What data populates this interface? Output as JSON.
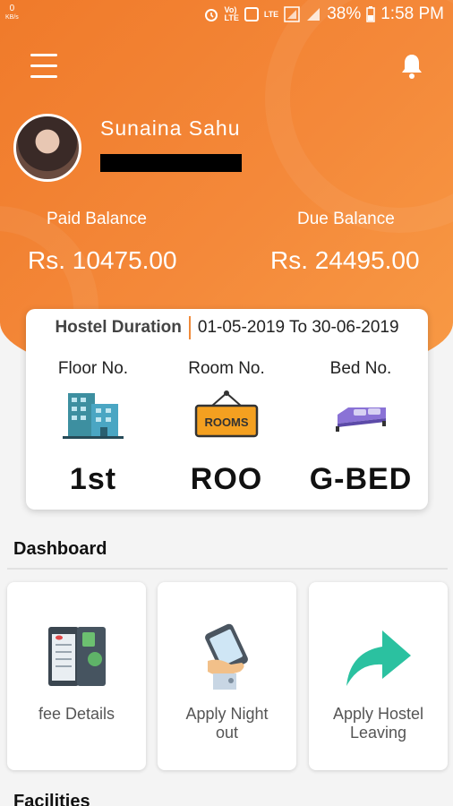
{
  "status_bar": {
    "net_speed": "0",
    "net_unit": "KB/s",
    "carrier_badge": "Vo)\nLTE",
    "lte_label": "LTE",
    "battery": "38%",
    "time": "1:58 PM"
  },
  "header": {
    "menu_icon": "hamburger-icon",
    "notification_icon": "bell-icon"
  },
  "profile": {
    "name": "Sunaina Sahu"
  },
  "balances": {
    "paid_label": "Paid Balance",
    "paid_value": "Rs. 10475.00",
    "due_label": "Due Balance",
    "due_value": "Rs. 24495.00"
  },
  "hostel": {
    "duration_label": "Hostel Duration",
    "duration_value": "01-05-2019 To 30-06-2019",
    "floor_label": "Floor No.",
    "floor_value": "1st",
    "room_label": "Room No.",
    "room_value": "ROO",
    "room_sign_text": "ROOMS",
    "bed_label": "Bed No.",
    "bed_value": "G-BED"
  },
  "dashboard": {
    "title": "Dashboard",
    "tiles": [
      {
        "label": "fee Details",
        "icon": "fee-details-icon"
      },
      {
        "label": "Apply Night out",
        "icon": "phone-hand-icon"
      },
      {
        "label": "Apply Hostel Leaving",
        "icon": "share-arrow-icon"
      }
    ]
  },
  "facilities": {
    "title": "Facilities"
  },
  "colors": {
    "brand_orange": "#f4893a",
    "arrow_teal": "#2bc1a0"
  }
}
